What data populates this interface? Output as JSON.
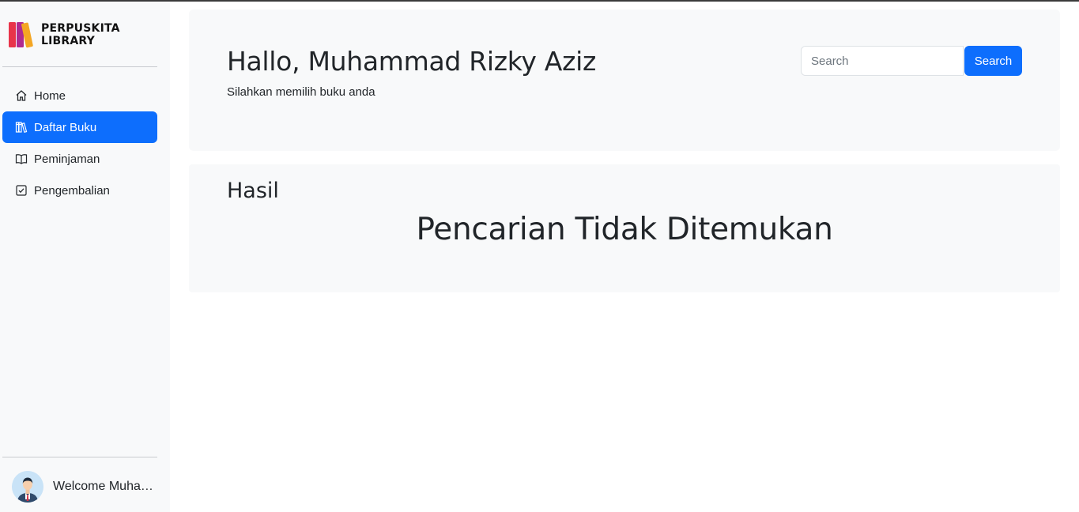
{
  "brand": {
    "line1": "PERPUSKITA",
    "line2": "LIBRARY",
    "logo_icon": "books-logo-icon"
  },
  "sidebar": {
    "items": [
      {
        "label": "Home",
        "icon": "house-icon",
        "active": false
      },
      {
        "label": "Daftar Buku",
        "icon": "bookshelf-icon",
        "active": true
      },
      {
        "label": "Peminjaman",
        "icon": "open-book-icon",
        "active": false
      },
      {
        "label": "Pengembalian",
        "icon": "checkbox-icon",
        "active": false
      }
    ],
    "user_text": "Welcome Muhammad Rizky Aziz"
  },
  "hero": {
    "title": "Hallo, Muhammad Rizky Aziz",
    "subtitle": "Silahkan memilih buku anda"
  },
  "search": {
    "placeholder": "Search",
    "value": "",
    "button_label": "Search"
  },
  "result": {
    "heading": "Hasil",
    "message": "Pencarian Tidak Ditemukan"
  },
  "colors": {
    "accent": "#0d6efd",
    "panel": "#f8f9fa",
    "text": "#212529"
  }
}
